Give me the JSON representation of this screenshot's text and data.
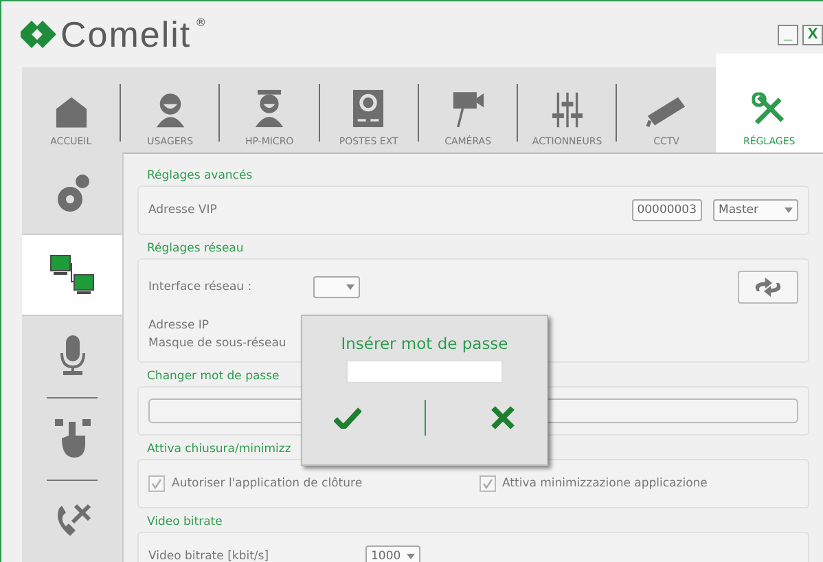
{
  "window": {
    "logo": "Comelit",
    "logo_mark": "®",
    "minimize": "_",
    "close": "X"
  },
  "tabs": [
    {
      "label": "ACCUEIL",
      "selected": false
    },
    {
      "label": "USAGERS",
      "selected": false
    },
    {
      "label": "HP-MICRO",
      "selected": false
    },
    {
      "label": "POSTES EXT",
      "selected": false
    },
    {
      "label": "CAMÉRAS",
      "selected": false
    },
    {
      "label": "ACTIONNEURS",
      "selected": false
    },
    {
      "label": "CCTV",
      "selected": false
    },
    {
      "label": "RÉGLAGES",
      "selected": true
    }
  ],
  "sidebar": {
    "items": [
      {
        "selected": false
      },
      {
        "selected": true
      },
      {
        "selected": false
      },
      {
        "selected": false
      },
      {
        "selected": false
      }
    ]
  },
  "sections": [
    {
      "kind": "vip",
      "title": "Réglages avancés",
      "label": "Adresse VIP",
      "value": "00000003",
      "mode": "Master"
    },
    {
      "kind": "network",
      "title": "Réglages réseau",
      "interface_label": "Interface réseau :",
      "ip_label": "Adresse IP",
      "mask_label": "Masque de sous-réseau"
    },
    {
      "kind": "password",
      "title": "Changer mot de passe"
    },
    {
      "kind": "checkboxes",
      "title": "Attiva chiusura/minimizz",
      "checkboxes": [
        {
          "label": "Autoriser l'application de clôture",
          "checked": true
        },
        {
          "label": "Attiva minimizzazione applicazione",
          "checked": true
        }
      ]
    },
    {
      "kind": "bitrate",
      "title": "Video bitrate",
      "label": "Video bitrate [kbit/s]",
      "value": "1000"
    }
  ],
  "dialog": {
    "title": "Insérer mot de passe"
  }
}
